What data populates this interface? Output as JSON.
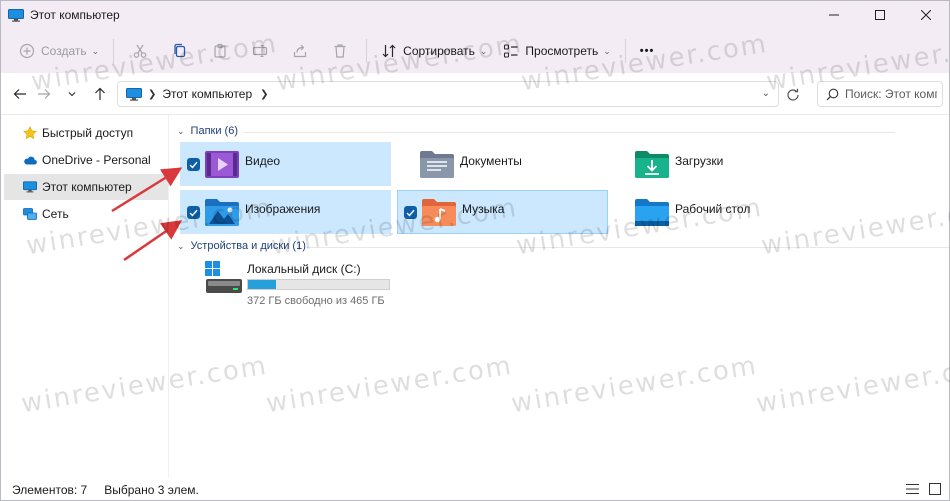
{
  "window": {
    "title": "Этот компьютер"
  },
  "toolbar": {
    "new_label": "Создать",
    "sort_label": "Сортировать",
    "view_label": "Просмотреть",
    "more_label": "•••"
  },
  "address": {
    "crumb": "Этот компьютер",
    "search_placeholder": "Поиск: Этот компь..."
  },
  "sidebar": {
    "items": [
      {
        "label": "Быстрый доступ",
        "icon": "star-icon",
        "selected": false
      },
      {
        "label": "OneDrive - Personal",
        "icon": "cloud-icon",
        "selected": false
      },
      {
        "label": "Этот компьютер",
        "icon": "computer-icon",
        "selected": true
      },
      {
        "label": "Сеть",
        "icon": "network-icon",
        "selected": false
      }
    ]
  },
  "folders_group": {
    "header": "Папки (6)",
    "items": [
      {
        "name": "Видео",
        "icon": "videos-folder-icon",
        "selected": true
      },
      {
        "name": "Документы",
        "icon": "documents-folder-icon",
        "selected": false
      },
      {
        "name": "Загрузки",
        "icon": "downloads-folder-icon",
        "selected": false
      },
      {
        "name": "Изображения",
        "icon": "pictures-folder-icon",
        "selected": true
      },
      {
        "name": "Музыка",
        "icon": "music-folder-icon",
        "selected": true
      },
      {
        "name": "Рабочий стол",
        "icon": "desktop-folder-icon",
        "selected": false
      }
    ]
  },
  "drives_group": {
    "header": "Устройства и диски (1)",
    "drive": {
      "name": "Локальный диск (C:)",
      "free_text": "372 ГБ свободно из 465 ГБ",
      "used_fraction": 0.2
    }
  },
  "status": {
    "items_count": "Элементов: 7",
    "selected_count": "Выбрано 3 элем."
  },
  "colors": {
    "accent": "#0f5fa8",
    "selection": "#cce8ff",
    "titlebar": "#f4ecf4",
    "annotation_arrow": "#d9383c"
  },
  "watermark": "winreviewer.com"
}
